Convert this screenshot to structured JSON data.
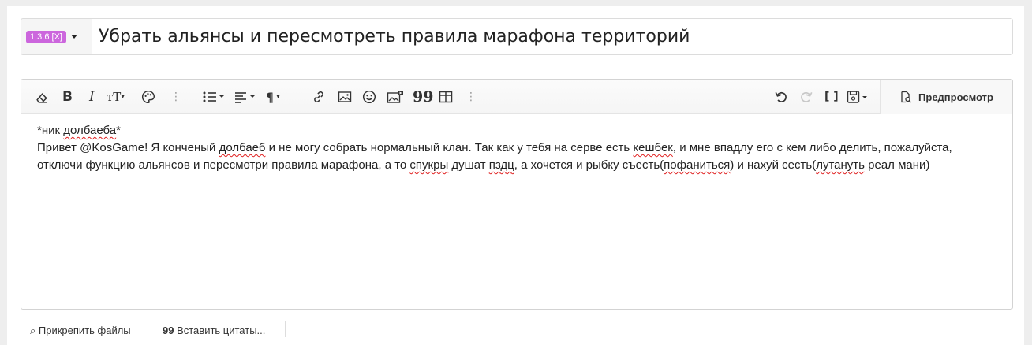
{
  "thread": {
    "prefix_label": "1.3.6 [X]",
    "title_value": "Убрать альянсы и пересмотреть правила марафона территорий"
  },
  "toolbar": {
    "icons": [
      "eraser-icon",
      "bold-icon",
      "italic-icon",
      "text-size-icon",
      "palette-icon",
      "more-icon",
      "list-icon",
      "align-icon",
      "paragraph-icon",
      "link-icon",
      "image-icon",
      "smiley-icon",
      "media-icon",
      "quote-icon",
      "table-icon",
      "more-icon",
      "undo-icon",
      "redo-icon",
      "bbcode-icon",
      "drafts-icon"
    ],
    "preview_label": "Предпросмотр"
  },
  "message": {
    "line1": "*ник долбаеба*",
    "p_a": "Привет @KosGame! Я конченый ",
    "w1": "долбаеб",
    "p_b": " и не могу собрать нормальный клан. Так как у тебя на серве есть ",
    "w2": "кешбек",
    "p_c": ", и мне впадлу его с кем либо делить, пожалуйста, отключи функцию альянсов  и пересмотри правила марафона, а то ",
    "w3": "спукры",
    "p_d": " душат ",
    "w4": "пздц",
    "p_e": ", а хочется и рыбку съесть(",
    "w5": "пофаниться",
    "p_f": ") и нахуй сесть(",
    "w6": "лутануть",
    "p_g": " реал мани)",
    "nick_w": "долбаеба"
  },
  "bottom": {
    "attach_label": "Прикрепить файлы",
    "insert_label": "Вставить цитаты..."
  },
  "colors": {
    "prefix_badge": "#cc66dd",
    "spellcheck": "#e02020"
  }
}
